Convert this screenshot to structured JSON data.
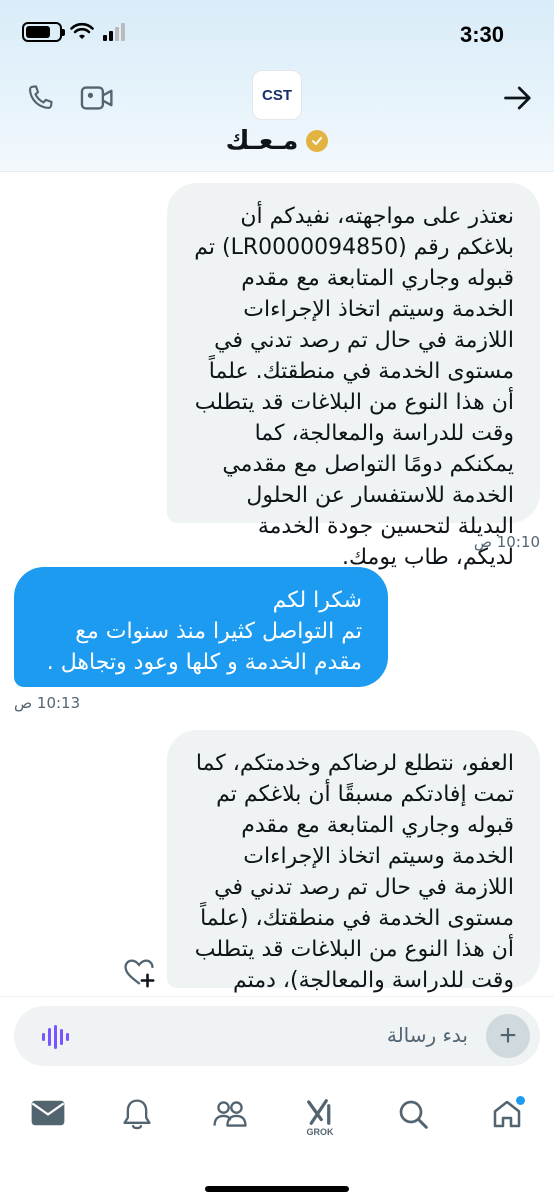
{
  "status_bar": {
    "time": "3:30",
    "battery_level": 0.75
  },
  "header": {
    "contact_name": "مـعـك",
    "avatar_text": "CST",
    "icons": {
      "call": "phone-icon",
      "video": "video-camera-icon",
      "back": "arrow-right-icon",
      "verified": "verified-badge-icon"
    }
  },
  "messages": [
    {
      "direction": "incoming",
      "text": "نعتذر على مواجهته، نفيدكم أن بلاغكم رقم (LR0000094850) تم قبوله وجاري المتابعة مع مقدم الخدمة وسيتم اتخاذ الإجراءات اللازمة في حال تم رصد تدني في مستوى الخدمة في منطقتك. علماً أن هذا النوع من البلاغات قد يتطلب وقت للدراسة والمعالجة، كما يمكنكم دومًا التواصل مع مقدمي الخدمة للاستفسار عن الحلول البديلة لتحسين جودة الخدمة لديكم، طاب يومك.",
      "time": "10:10 ص"
    },
    {
      "direction": "outgoing",
      "text": "شكرا لكم\nتم التواصل كثيرا منذ سنوات مع مقدم الخدمة و كلها وعود وتجاهل .",
      "time": "10:13 ص"
    },
    {
      "direction": "incoming",
      "text": "العفو، نتطلع لرضاكم وخدمتكم، كما تمت إفادتكم مسبقًا أن بلاغكم تم قبوله وجاري المتابعة مع مقدم الخدمة وسيتم اتخاذ الإجراءات اللازمة في حال تم رصد تدني في مستوى الخدمة في منطقتك، (علماً أن هذا النوع من البلاغات قد يتطلب وقت للدراسة والمعالجة)، دمتم بخير."
    }
  ],
  "composer": {
    "placeholder": "بدء رسالة",
    "plus": "+"
  },
  "tabbar": {
    "grok_label": "GROK"
  },
  "colors": {
    "accent": "#1d9bf0",
    "incoming_bubble": "#eff3f4",
    "verified_gold": "#e3b341"
  }
}
